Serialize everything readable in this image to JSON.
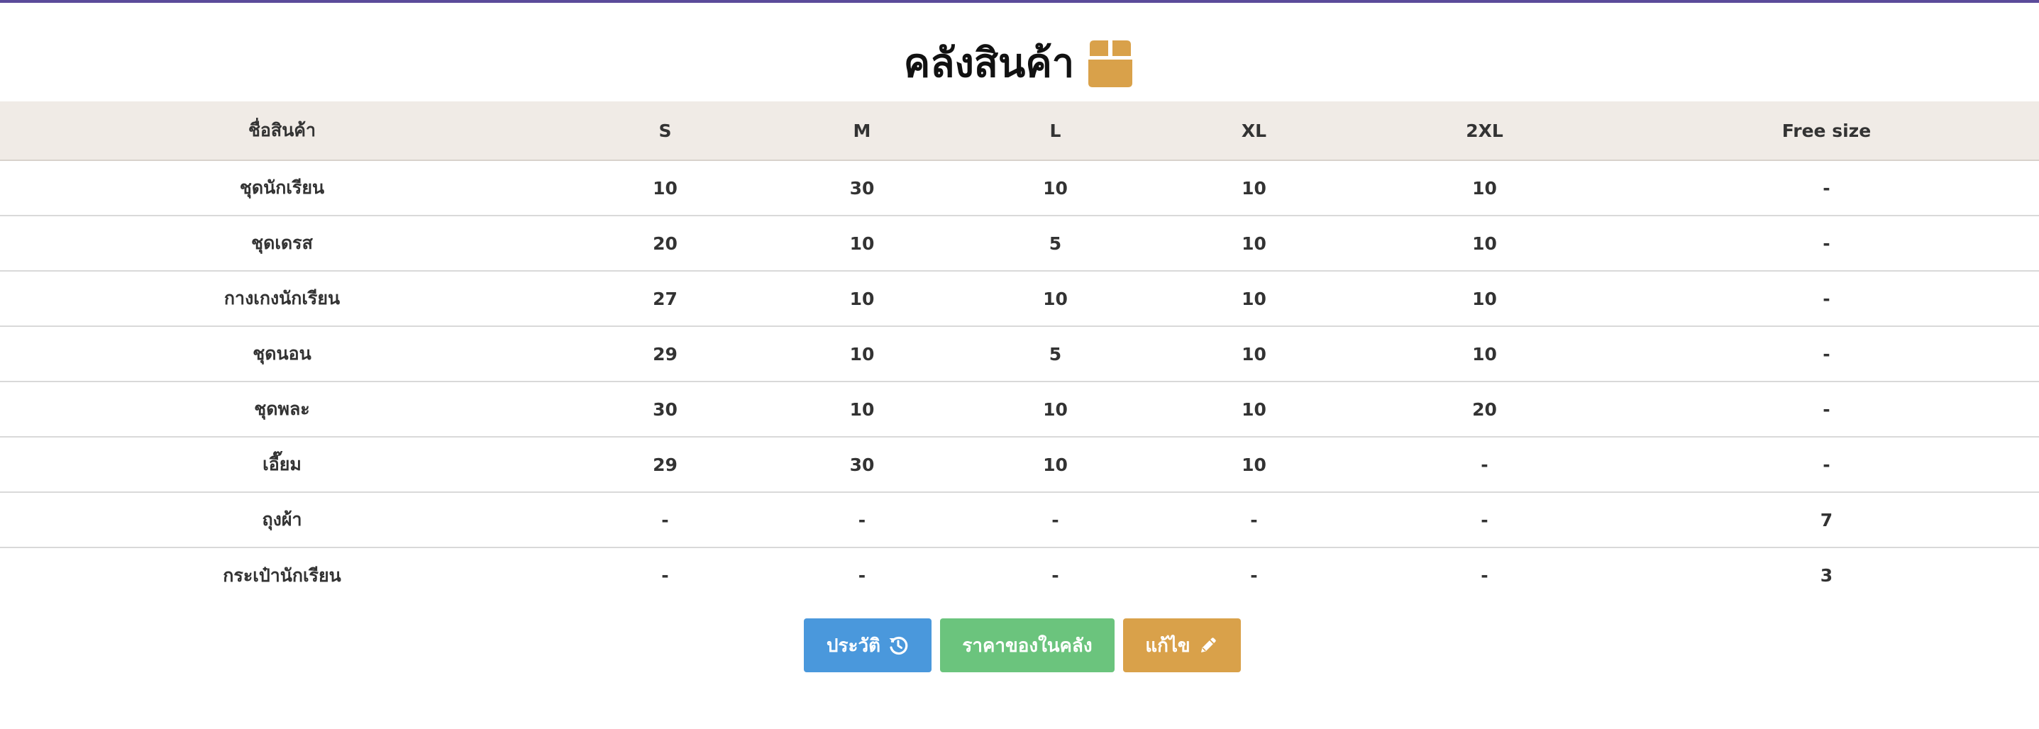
{
  "page": {
    "title": "คลังสินค้า",
    "icon": "box-icon",
    "accent_color": "#5b4b9a",
    "box_icon_color": "#d9a14a"
  },
  "table": {
    "columns": [
      "ชื่อสินค้า",
      "S",
      "M",
      "L",
      "XL",
      "2XL",
      "Free size"
    ],
    "rows": [
      [
        "ชุดนักเรียน",
        "10",
        "30",
        "10",
        "10",
        "10",
        "-"
      ],
      [
        "ชุดเดรส",
        "20",
        "10",
        "5",
        "10",
        "10",
        "-"
      ],
      [
        "กางเกงนักเรียน",
        "27",
        "10",
        "10",
        "10",
        "10",
        "-"
      ],
      [
        "ชุดนอน",
        "29",
        "10",
        "5",
        "10",
        "10",
        "-"
      ],
      [
        "ชุดพละ",
        "30",
        "10",
        "10",
        "10",
        "20",
        "-"
      ],
      [
        "เอี๊ยม",
        "29",
        "30",
        "10",
        "10",
        "-",
        "-"
      ],
      [
        "ถุงผ้า",
        "-",
        "-",
        "-",
        "-",
        "-",
        "7"
      ],
      [
        "กระเป๋านักเรียน",
        "-",
        "-",
        "-",
        "-",
        "-",
        "3"
      ]
    ]
  },
  "buttons": {
    "history": {
      "label": "ประวัติ",
      "icon": "history-icon",
      "color": "#4a98dc"
    },
    "price": {
      "label": "ราคาของในคลัง",
      "color": "#6bc47d"
    },
    "edit": {
      "label": "แก้ไข",
      "icon": "pencil-icon",
      "color": "#d9a14a"
    }
  }
}
